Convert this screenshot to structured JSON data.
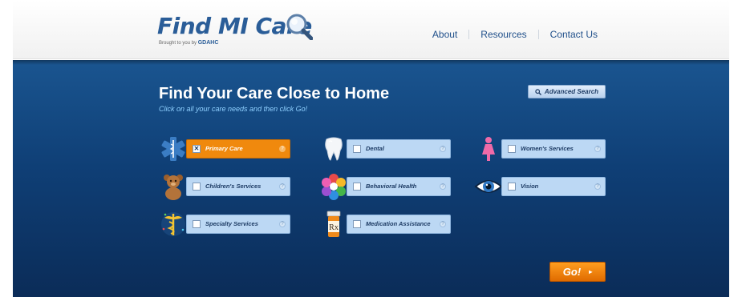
{
  "header": {
    "logo_text": "Find MI Care",
    "logo_sub_prefix": "Brought to you by",
    "logo_sub_brand": "GDAHC",
    "nav": [
      {
        "label": "About"
      },
      {
        "label": "Resources"
      },
      {
        "label": "Contact Us"
      }
    ]
  },
  "main": {
    "title": "Find Your Care Close to Home",
    "subtitle": "Click on all your care needs and then click Go!",
    "advanced_search_label": "Advanced Search",
    "go_label": "Go!",
    "options": [
      {
        "label": "Primary Care",
        "checked": true,
        "icon": "medical-star-icon"
      },
      {
        "label": "Dental",
        "checked": false,
        "icon": "tooth-icon"
      },
      {
        "label": "Women's Services",
        "checked": false,
        "icon": "woman-icon"
      },
      {
        "label": "Children's Services",
        "checked": false,
        "icon": "teddy-bear-icon"
      },
      {
        "label": "Behavioral Health",
        "checked": false,
        "icon": "colorful-burst-icon"
      },
      {
        "label": "Vision",
        "checked": false,
        "icon": "eye-icon"
      },
      {
        "label": "Specialty Services",
        "checked": false,
        "icon": "caduceus-icon"
      },
      {
        "label": "Medication Assistance",
        "checked": false,
        "icon": "prescription-bottle-icon"
      }
    ],
    "info_glyph": "?",
    "check_glyph": "✕"
  },
  "colors": {
    "accent_orange": "#f0890d",
    "panel_blue": "#0f3f76",
    "option_blue": "#bcd8f4",
    "logo_blue": "#2a5d98"
  }
}
